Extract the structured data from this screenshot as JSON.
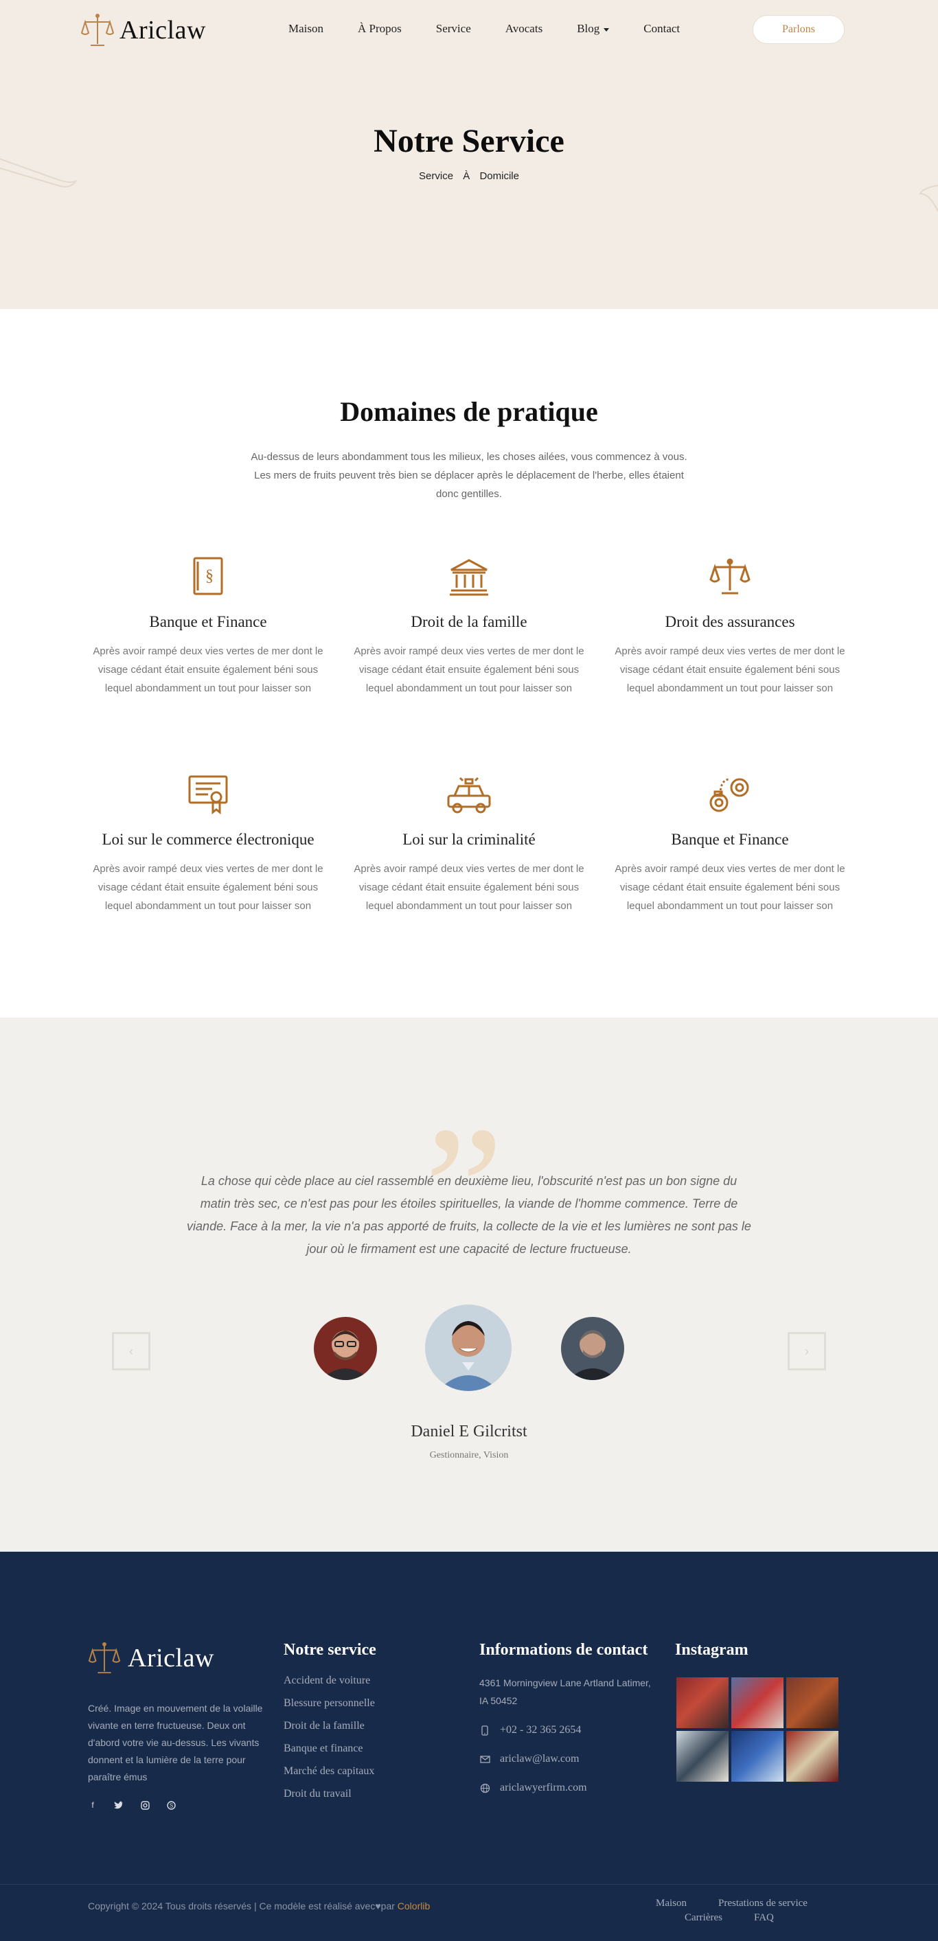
{
  "brand": {
    "name": "Ariclaw",
    "accent": "#b9854b",
    "footer_bg": "#182a49"
  },
  "nav": {
    "items": [
      "Maison",
      "À Propos",
      "Service",
      "Avocats",
      "Blog",
      "Contact"
    ],
    "cta": "Parlons"
  },
  "hero": {
    "title": "Notre Service",
    "breadcrumb": {
      "first": "Service",
      "separator": "À",
      "current": "Domicile"
    }
  },
  "practice": {
    "title": "Domaines de pratique",
    "description": "Au-dessus de leurs abondamment tous les milieux, les choses ailées, vous commencez à vous. Les mers de fruits peuvent très bien se déplacer après le déplacement de l'herbe, elles étaient donc gentilles.",
    "cards": [
      {
        "icon": "law-book-icon",
        "title": "Banque et Finance",
        "text": "Après avoir rampé deux vies vertes de mer dont le visage cédant était ensuite également béni sous lequel abondamment un tout pour laisser son"
      },
      {
        "icon": "courthouse-icon",
        "title": "Droit de la famille",
        "text": "Après avoir rampé deux vies vertes de mer dont le visage cédant était ensuite également béni sous lequel abondamment un tout pour laisser son"
      },
      {
        "icon": "scales-icon",
        "title": "Droit des assurances",
        "text": "Après avoir rampé deux vies vertes de mer dont le visage cédant était ensuite également béni sous lequel abondamment un tout pour laisser son"
      },
      {
        "icon": "certificate-icon",
        "title": "Loi sur le commerce électronique",
        "text": "Après avoir rampé deux vies vertes de mer dont le visage cédant était ensuite également béni sous lequel abondamment un tout pour laisser son"
      },
      {
        "icon": "police-car-icon",
        "title": "Loi sur la criminalité",
        "text": "Après avoir rampé deux vies vertes de mer dont le visage cédant était ensuite également béni sous lequel abondamment un tout pour laisser son"
      },
      {
        "icon": "handcuffs-icon",
        "title": "Banque et Finance",
        "text": "Après avoir rampé deux vies vertes de mer dont le visage cédant était ensuite également béni sous lequel abondamment un tout pour laisser son"
      }
    ]
  },
  "testimonial": {
    "quote": "La chose qui cède place au ciel rassemblé en deuxième lieu, l'obscurité n'est pas un bon signe du matin très sec, ce n'est pas pour les étoiles spirituelles, la viande de l'homme commence. Terre de viande. Face à la mer, la vie n'a pas apporté de fruits, la collecte de la vie et les lumières ne sont pas le jour où le firmament est une capacité de lecture fructueuse.",
    "name": "Daniel E Gilcritst",
    "role": "Gestionnaire, Vision",
    "prev": "‹",
    "next": "›"
  },
  "footer": {
    "about": "Créé. Image en mouvement de la volaille vivante en terre fructueuse. Deux ont d'abord votre vie au-dessus. Les vivants donnent et la lumière de la terre pour paraître émus",
    "social": [
      "facebook-icon",
      "twitter-icon",
      "instagram-icon",
      "skype-icon"
    ],
    "services_title": "Notre service",
    "services": [
      "Accident de voiture",
      "Blessure personnelle",
      "Droit de la famille",
      "Banque et finance",
      "Marché des capitaux",
      "Droit du travail"
    ],
    "contact_title": "Informations de contact",
    "address": "4361 Morningview Lane Artland Latimer, IA 50452",
    "phone": "+02 - 32 365 2654",
    "email": "ariclaw@law.com",
    "website": "ariclawyerfirm.com",
    "instagram_title": "Instagram",
    "copyright_prefix": "Copyright © 2024 Tous droits réservés | Ce modèle est réalisé avec",
    "copyright_by": "par",
    "copyright_brand": "Colorlib",
    "bottom_links": [
      "Maison",
      "Prestations de service",
      "Carrières",
      "FAQ"
    ]
  }
}
